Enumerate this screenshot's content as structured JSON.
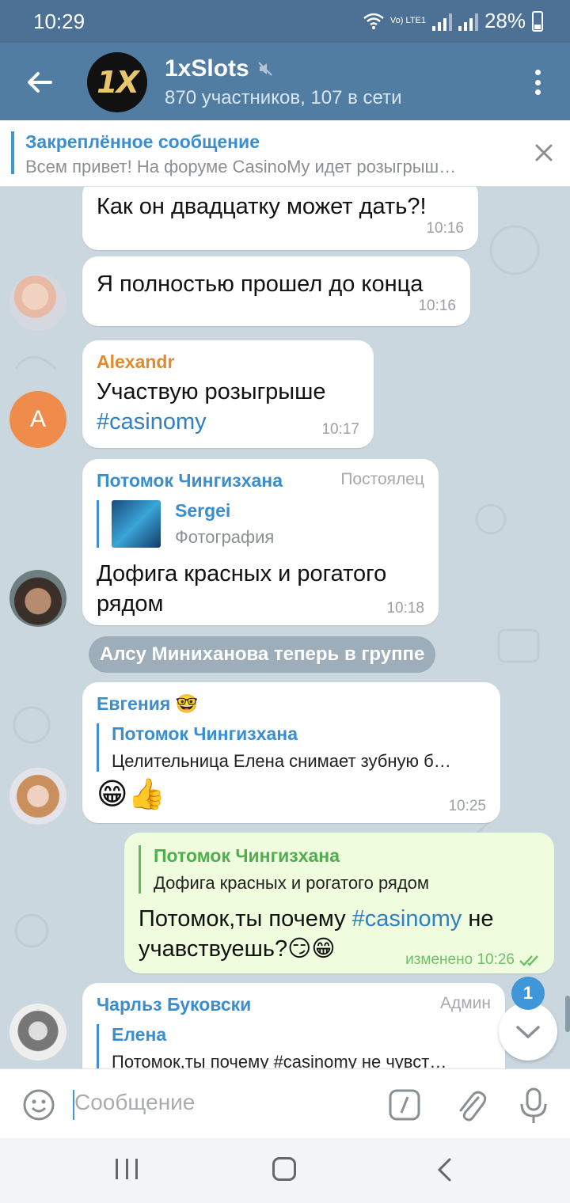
{
  "status": {
    "time": "10:29",
    "battery": "28%",
    "network_label": "Vo) LTE1"
  },
  "header": {
    "title": "1xSlots",
    "subtitle": "870 участников, 107 в сети",
    "avatar_text": "1X"
  },
  "pinned": {
    "title": "Закреплённое сообщение",
    "text": "Всем привет! На форуме CasinoMy идет розыгрыш…"
  },
  "messages": [
    {
      "text": "Как он двадцатку может дать?!",
      "time": "10:16"
    },
    {
      "text": "Я полностью прошел до конца",
      "time": "10:16"
    },
    {
      "sender": "Alexandr",
      "sender_color": "#e08a2d",
      "text_plain": "Участвую розыгрыше",
      "hashtag": "#casinomy",
      "time": "10:17",
      "avatar_letter": "A",
      "avatar_color": "#ef8c4b"
    },
    {
      "sender": "Потомок Чингизхана",
      "tag": "Постоялец",
      "reply_name": "Sergei",
      "reply_text": "Фотография",
      "text": "Дофига красных и рогатого рядом",
      "time": "10:18"
    },
    {
      "service": "Алсу Миниханова теперь в группе"
    },
    {
      "sender": "Евгения",
      "sender_emoji": "🤓",
      "reply_name": "Потомок Чингизхана",
      "reply_text": "Целительница Елена снимает зубную б…",
      "text": "😁👍",
      "time": "10:25"
    },
    {
      "reply_name": "Потомок Чингизхана",
      "reply_text": "Дофига красных и рогатого рядом",
      "text_plain_a": "Потомок,ты почему ",
      "hashtag": "#casinomy",
      "text_plain_b": " не учавствуешь?😏😁",
      "time": "изменено 10:26"
    },
    {
      "sender": "Чарльз Буковски",
      "tag": "Админ",
      "reply_name": "Елена",
      "reply_text": "Потомок,ты почему #casinomy не чувст…"
    }
  ],
  "scroll_badge": "1",
  "input": {
    "placeholder": "Сообщение"
  },
  "colors": {
    "header": "#517da2",
    "accent": "#3f97da",
    "outgoing": "#effdde"
  }
}
